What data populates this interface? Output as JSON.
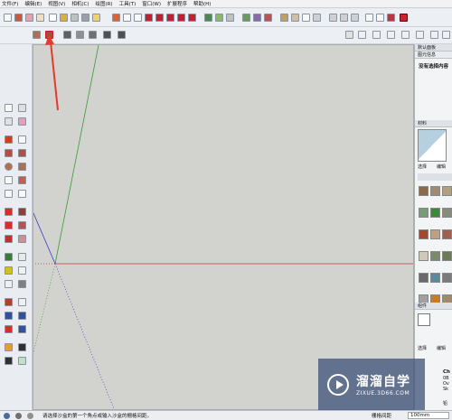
{
  "menu": [
    "文件(F)",
    "编辑(E)",
    "视图(V)",
    "相机(C)",
    "绘图(R)",
    "工具(T)",
    "窗口(W)",
    "扩展程序",
    "帮助(H)"
  ],
  "tray": {
    "default_tray": "默认面板",
    "entity_info": "图元信息",
    "no_selection": "没有选择内容",
    "materials": "材料",
    "tab_select": "选择",
    "tab_edit": "编辑",
    "components": "组件",
    "comp_tab_select": "选择",
    "comp_tab_edit": "编辑",
    "comp_name_fragment": "Ch",
    "comp_line1": "0B",
    "comp_line2": "Ov",
    "comp_line3": "Sk",
    "comp_bottom": "铅"
  },
  "status": {
    "hint": "请选择沙盒的第一个角点或输入沙盒的栅格间距。",
    "measurement_label": "栅格间距",
    "measurement_value": "100mm"
  },
  "watermark": {
    "brand": "溜溜自学",
    "url": "ZIXUE.3D66.COM"
  },
  "colors": {
    "x_axis": "#c23a3a",
    "y_axis": "#3a9a3a",
    "z_axis": "#3a3acc",
    "annotation_arrow": "#e23b30",
    "viewport_bg": "#d2d3ce"
  }
}
